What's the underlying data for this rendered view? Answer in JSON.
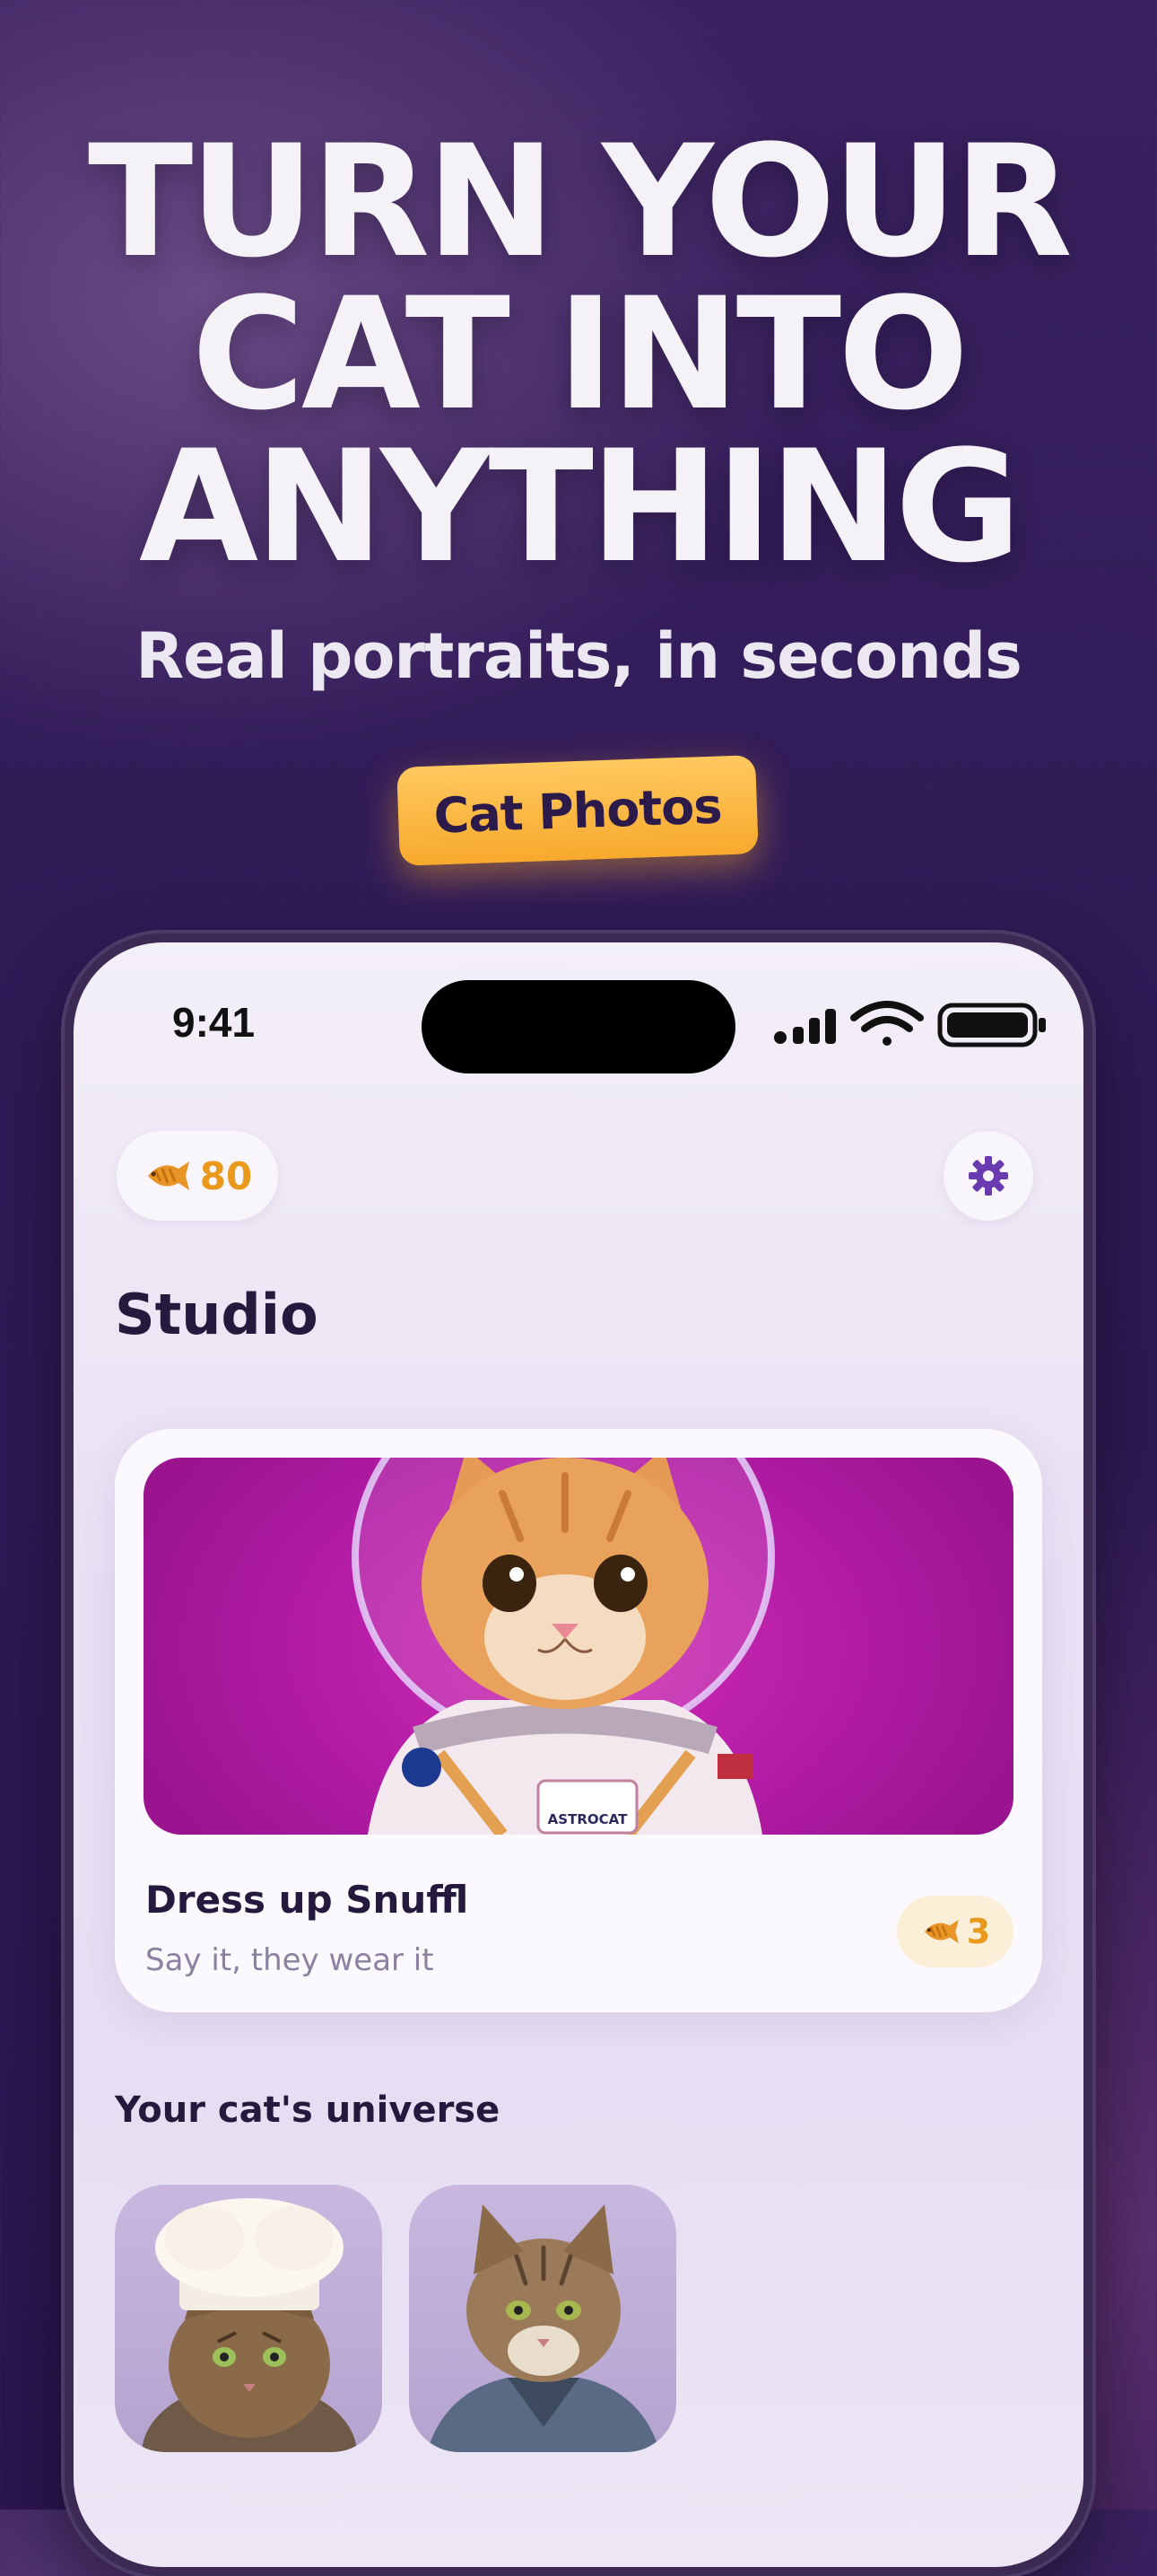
{
  "hero": {
    "title_lines": [
      "TURN YOUR",
      "CAT INTO",
      "ANYTHING"
    ],
    "subtitle": "Real portraits, in seconds",
    "cta_label": "Cat Photos"
  },
  "status_bar": {
    "time": "9:41"
  },
  "app": {
    "coins": {
      "icon": "fish-coin-icon",
      "count": "80"
    },
    "settings_icon": "gear-icon",
    "page_title": "Studio",
    "featured_card": {
      "title": "Dress up Snuffl",
      "subtitle": "Say it, they wear it",
      "cost": "3",
      "image_badge": "ASTROCAT"
    },
    "section_title": "Your cat's universe",
    "thumbnails": [
      "chef-cat-portrait",
      "denim-jacket-cat-portrait"
    ]
  },
  "colors": {
    "background": "#2e1a55",
    "accent_orange": "#f7a92d",
    "coin_text": "#e99a1c",
    "brand_purple": "#6a3ab0",
    "card_magenta": "#c024ae"
  }
}
